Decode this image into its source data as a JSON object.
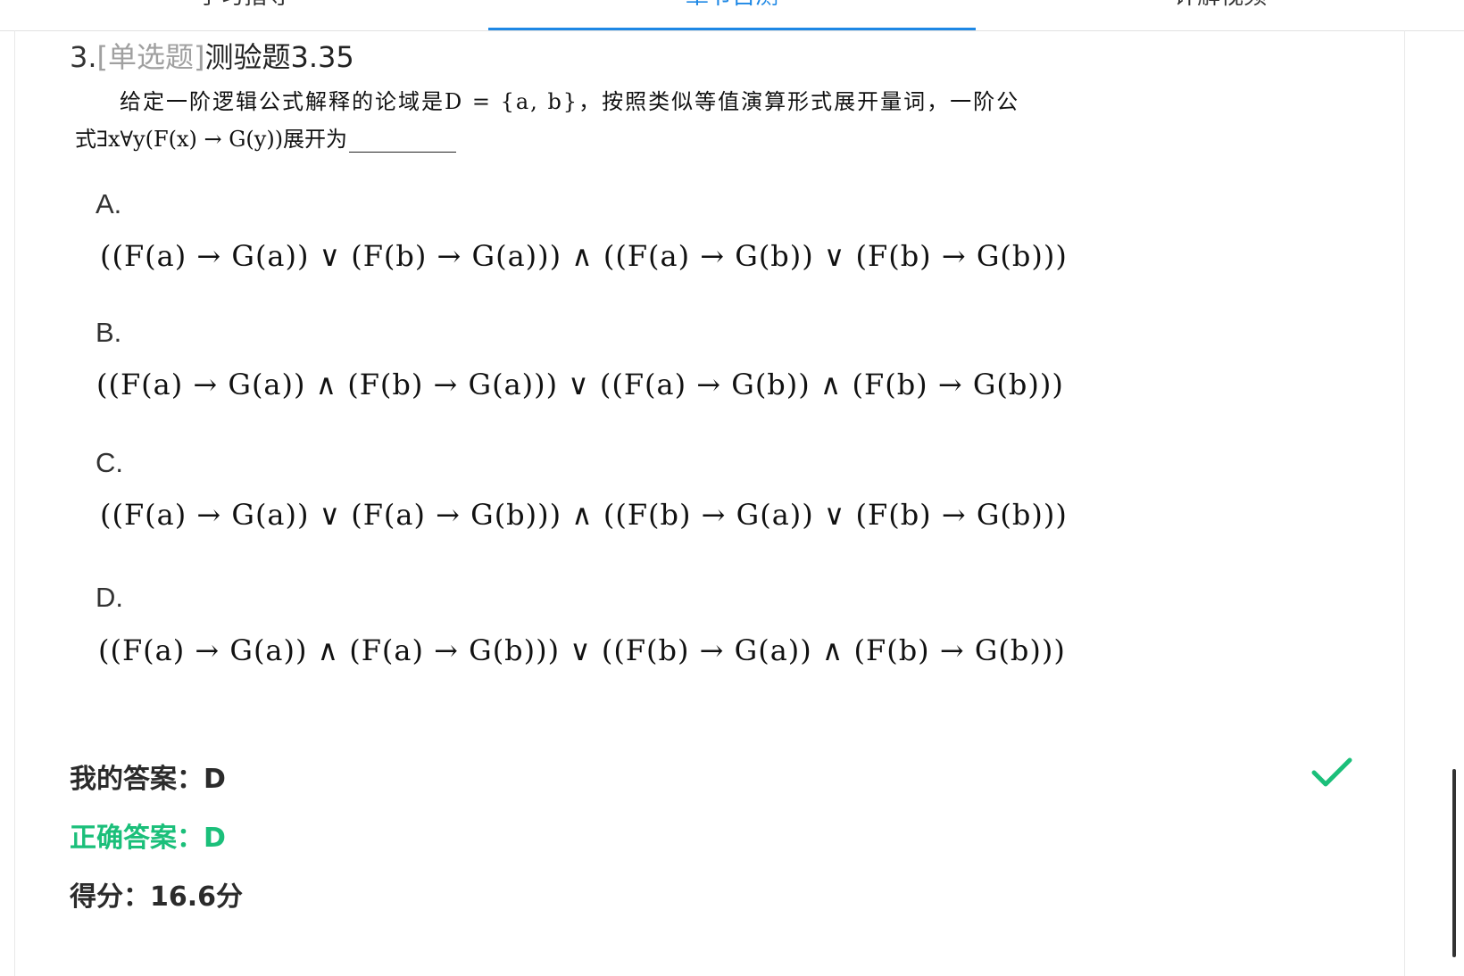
{
  "tabs": [
    {
      "label": "学习指导",
      "active": false
    },
    {
      "label": "章节自测",
      "active": true
    },
    {
      "label": "详解视频",
      "active": false
    }
  ],
  "question": {
    "number": "3.",
    "type": "[单选题]",
    "title": "测验题3.35",
    "stem_line1": "给定一阶逻辑公式解释的论域是D = {a, b}，按照类似等值演算形式展开量词，一阶公",
    "stem_line2": "式∃x∀y(F(x) → G(y))展开为"
  },
  "options": [
    {
      "letter": "A.",
      "formula": "((F(a) → G(a)) ∨ (F(b) → G(a))) ∧ ((F(a) → G(b)) ∨ (F(b) → G(b)))"
    },
    {
      "letter": "B.",
      "formula": "((F(a) → G(a)) ∧ (F(b) → G(a))) ∨ ((F(a) → G(b)) ∧ (F(b) → G(b)))"
    },
    {
      "letter": "C.",
      "formula": "((F(a) → G(a)) ∨ (F(a) → G(b))) ∧ ((F(b) → G(a)) ∨ (F(b) → G(b)))"
    },
    {
      "letter": "D.",
      "formula": "((F(a) → G(a)) ∧ (F(a) → G(b))) ∨ ((F(b) → G(a)) ∧ (F(b) → G(b)))"
    }
  ],
  "result": {
    "my_answer": "我的答案：D",
    "correct_answer": "正确答案：D",
    "score": "得分：16.6分"
  },
  "colors": {
    "accent": "#1e88e5",
    "correct": "#1bbf7a",
    "muted": "#a0a0a0"
  },
  "icons": {
    "status": "check-icon"
  }
}
